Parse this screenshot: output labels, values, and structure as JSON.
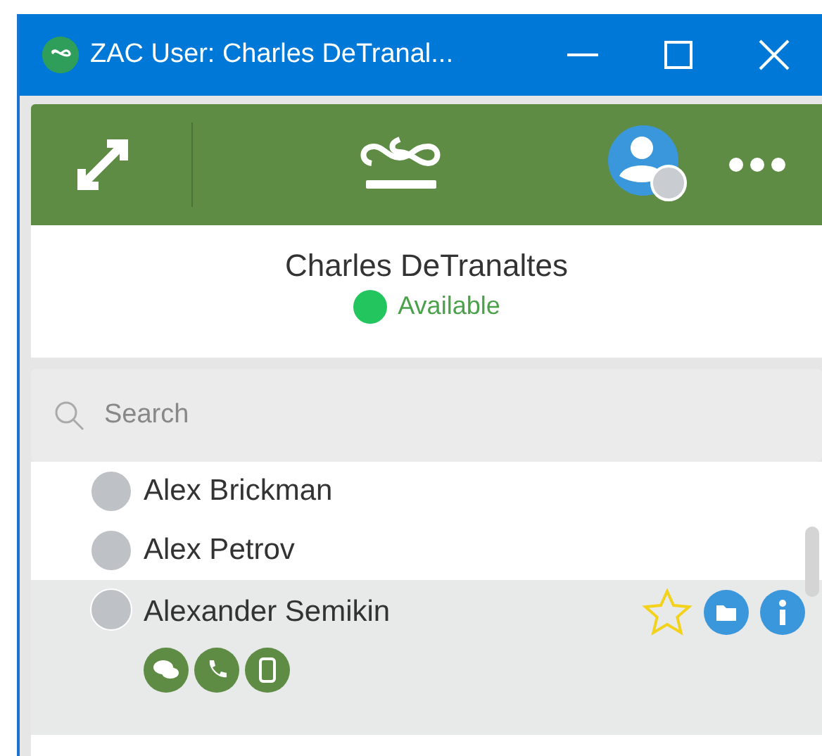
{
  "window": {
    "title": "ZAC User: Charles DeTranal..."
  },
  "profile": {
    "name": "Charles DeTranaltes",
    "status": "Available",
    "online": true
  },
  "search": {
    "placeholder": "Search"
  },
  "contacts": [
    {
      "name": "Alex Brickman",
      "selected": false
    },
    {
      "name": "Alex Petrov",
      "selected": false
    },
    {
      "name": "Alexander Semikin",
      "selected": true,
      "favorite": false
    }
  ]
}
